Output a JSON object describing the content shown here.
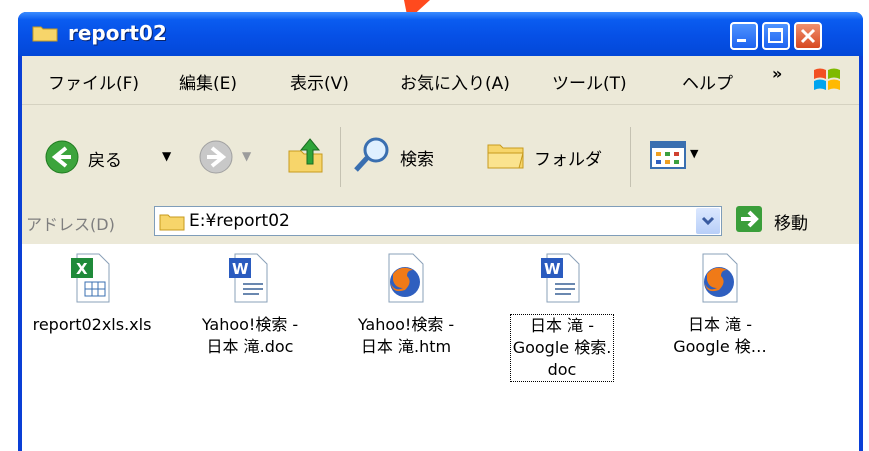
{
  "window": {
    "title": "report02"
  },
  "menu": {
    "items": [
      "ファイル(F)",
      "編集(E)",
      "表示(V)",
      "お気に入り(A)",
      "ツール(T)",
      "ヘルプ"
    ],
    "chevron": "»"
  },
  "toolbar": {
    "back": "戻る",
    "search": "検索",
    "folder": "フォルダ"
  },
  "address": {
    "label": "アドレス(D)",
    "path": "E:¥report02",
    "go": "移動"
  },
  "files": [
    {
      "name": "report02xls.xls",
      "type": "excel-icon"
    },
    {
      "name": "Yahoo!検索 -\n日本 滝.doc",
      "type": "word-icon"
    },
    {
      "name": "Yahoo!検索 -\n日本 滝.htm",
      "type": "firefox-icon"
    },
    {
      "name": "日本 滝 -\nGoogle 検索.\ndoc",
      "type": "word-icon",
      "selected": true
    },
    {
      "name": "日本 滝 -\nGoogle 検…",
      "type": "firefox-icon"
    }
  ],
  "colors": {
    "titlebar": "#0650e6",
    "chrome": "#ece9d8",
    "arrow": "#ff4a1e"
  }
}
